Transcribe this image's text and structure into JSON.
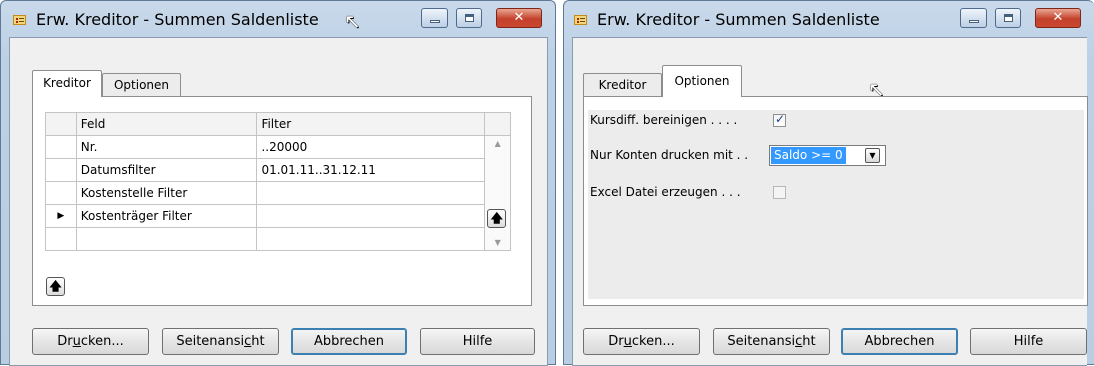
{
  "left_window": {
    "title": "Erw. Kreditor - Summen Saldenliste",
    "tabs": [
      {
        "label": "Kreditor",
        "selected": true
      },
      {
        "label": "Optionen",
        "selected": false
      }
    ],
    "grid": {
      "columns": [
        "Feld",
        "Filter"
      ],
      "rows": [
        {
          "feld": "Nr.",
          "filter": "..20000",
          "current": false
        },
        {
          "feld": "Datumsfilter",
          "filter": "01.01.11..31.12.11",
          "current": false
        },
        {
          "feld": "Kostenstelle Filter",
          "filter": "",
          "current": true
        },
        {
          "feld": "Kostenträger Filter",
          "filter": "",
          "current": false
        },
        {
          "feld": "",
          "filter": "",
          "current": false
        }
      ]
    },
    "buttons": {
      "print_pre": "Dr",
      "print_mnemonic": "u",
      "print_post": "cken...",
      "preview_pre": "Seitenansi",
      "preview_mnemonic": "c",
      "preview_post": "ht",
      "cancel": "Abbrechen",
      "help": "Hilfe"
    }
  },
  "right_window": {
    "title": "Erw. Kreditor - Summen Saldenliste",
    "tabs": [
      {
        "label": "Kreditor",
        "selected": false
      },
      {
        "label": "Optionen",
        "selected": true
      }
    ],
    "options": {
      "kursdiff_label": "Kursdiff. bereinigen . . . .",
      "kursdiff_checked": true,
      "nur_konten_label": "Nur Konten drucken mit . .",
      "nur_konten_value": "Saldo >= 0",
      "excel_label": "Excel Datei erzeugen . . .",
      "excel_checked": false
    },
    "buttons": {
      "print_pre": "Dr",
      "print_mnemonic": "u",
      "print_post": "cken...",
      "preview_pre": "Seitenansi",
      "preview_mnemonic": "c",
      "preview_post": "ht",
      "cancel": "Abbrechen",
      "help": "Hilfe"
    }
  },
  "icons": {
    "app": "report-icon",
    "minimize": "minimize-icon",
    "maximize": "maximize-icon",
    "close": "close-icon",
    "cursor": "mouse-pointer-icon",
    "row_pointer": "row-pointer-icon",
    "scroll_up": "scroll-up-icon",
    "scroll_down": "scroll-down-icon",
    "move_up": "up-arrow-icon"
  },
  "colors": {
    "title_bar": "#bcd0e6",
    "close_button": "#c4412c",
    "selection": "#3399ff",
    "checkbox_mark": "#1b3f92"
  }
}
